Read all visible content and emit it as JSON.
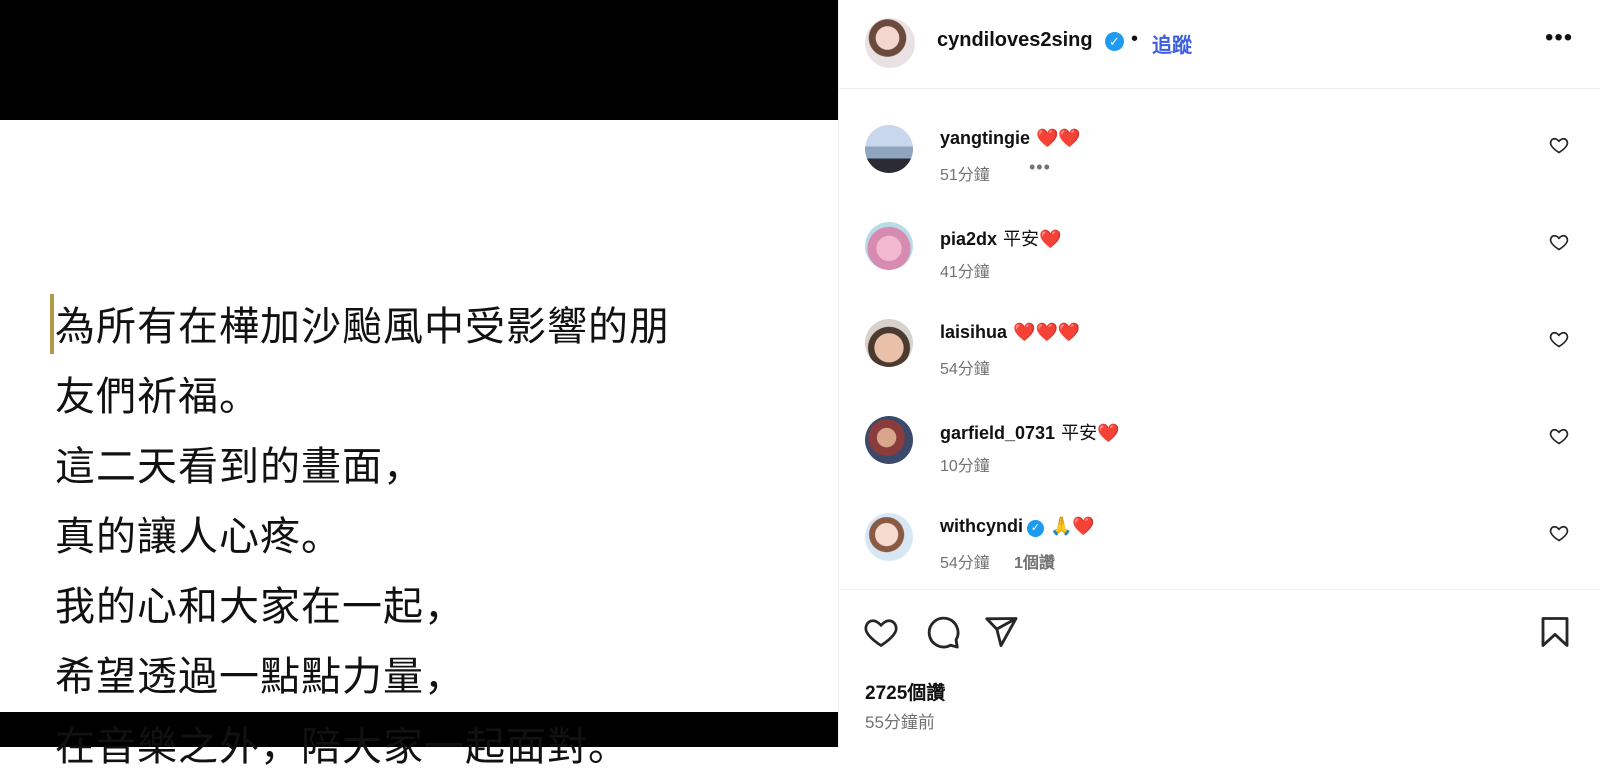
{
  "post": {
    "lines": [
      "為所有在樺加沙颱風中受影響的朋",
      "友們祈福。",
      "這二天看到的畫面，",
      "真的讓人心疼。",
      "我的心和大家在一起，",
      "希望透過一點點力量，",
      "在音樂之外，陪大家一起面對。"
    ]
  },
  "header": {
    "username": "cyndiloves2sing",
    "separator": "•",
    "follow_label": "追蹤",
    "more_label": "•••"
  },
  "comments": [
    {
      "user": "yangtingie",
      "text": "❤️❤️",
      "time": "51分鐘",
      "more": "•••",
      "likes": ""
    },
    {
      "user": "pia2dx",
      "text": "平安❤️",
      "time": "41分鐘",
      "more": "",
      "likes": ""
    },
    {
      "user": "laisihua",
      "text": "❤️❤️❤️",
      "time": "54分鐘",
      "more": "",
      "likes": ""
    },
    {
      "user": "garfield_0731",
      "text": "平安❤️",
      "time": "10分鐘",
      "more": "",
      "likes": ""
    },
    {
      "user": "withcyndi",
      "text": "🙏❤️",
      "time": "54分鐘",
      "more": "",
      "likes": "1個讚"
    }
  ],
  "footer": {
    "likes": "2725個讚",
    "timestamp": "55分鐘前"
  },
  "icons": {
    "verified": "verified-badge-icon",
    "like": "heart-icon",
    "comment": "comment-icon",
    "share": "send-icon",
    "save": "bookmark-icon"
  },
  "colors": {
    "follow": "#3e5fe0",
    "verified": "#1d9bf0",
    "meta": "#737373",
    "media_background": "#000000"
  }
}
